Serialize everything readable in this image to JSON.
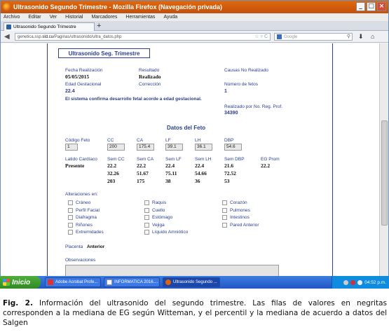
{
  "window": {
    "title": "Ultrasonido Segundo Trimestre - Mozilla Firefox (Navegación privada)",
    "min_symbol": "_",
    "max_symbol": "□",
    "close_symbol": "×"
  },
  "menu": {
    "items": [
      "Archivo",
      "Editar",
      "Ver",
      "Historial",
      "Marcadores",
      "Herramientas",
      "Ayuda"
    ]
  },
  "tab": {
    "label": "Ultrasonido Segundo Trimestre",
    "new_tab": "+"
  },
  "nav": {
    "url_prefix": "genetica.ssp.",
    "url_host": "sld.cu",
    "url_path": "/Paginas/ultrasonido/ultra_datos.php",
    "url_icons": "☆ ▿ C",
    "search_placeholder": "Google",
    "back_symbol": "◀",
    "download_symbol": "⬇",
    "home_symbol": "⌂"
  },
  "page": {
    "section_title": "Ultrasonido Seg. Trimestre",
    "fecha_label": "Fecha Realización",
    "fecha_value": "05/05/2015",
    "resultado_label": "Resultado",
    "resultado_value": "Realizado",
    "causas_label": "Causas No Realizado",
    "edad_label": "Edad Gestacional",
    "edad_value": "22.4",
    "correccion_label": "Corrección",
    "fetos_label": "Número de fetos",
    "fetos_value": "1",
    "confirm_msg": "El sistema confirma desarrollo fetal acorde a edad gestacional.",
    "realizado_label": "Realizado por No. Reg. Prof.",
    "realizado_value": "34390",
    "datos_title": "Datos del Feto",
    "fields": [
      {
        "label": "Código Feto",
        "value": "1"
      },
      {
        "label": "CC",
        "value": "200"
      },
      {
        "label": "CA",
        "value": "175.4"
      },
      {
        "label": "LF",
        "value": "39.1"
      },
      {
        "label": "LH",
        "value": "36.1"
      },
      {
        "label": "DBP",
        "value": "54.6"
      }
    ],
    "latido_label": "Latido Cardíaco",
    "latido_value": "Presente",
    "sem_headers": [
      "Sem CC",
      "Sem CA",
      "Sem LF",
      "Sem LH",
      "Sem DBP",
      "EG Prom"
    ],
    "sem_rows": [
      [
        "22.2",
        "22.2",
        "22.4",
        "22.4",
        "21.6",
        "22.2"
      ],
      [
        "32.26",
        "51.67",
        "75.11",
        "54.66",
        "72.52",
        ""
      ],
      [
        "203",
        "175",
        "38",
        "36",
        "53",
        ""
      ]
    ],
    "alteraciones_label": "Alteraciones en:",
    "checkboxes": [
      "Cráneo",
      "Raquis",
      "Corazón",
      "Perfil Facial",
      "Cuello",
      "Pulmones",
      "Diafragma",
      "Estómago",
      "Intestinos",
      "Riñones",
      "Vejiga",
      "Pared Anterior",
      "Extremidades",
      "Líquido Amniótico"
    ],
    "placenta_label": "Placenta",
    "placenta_value": "Anterior",
    "observaciones_label": "Observaciones"
  },
  "taskbar": {
    "start": "Inicio",
    "tasks": [
      "Adobe Acrobat Profe...",
      "INFORMATICA 2016....",
      "Ultrasonido Segundo ..."
    ],
    "clock": "04:52 p.m."
  },
  "caption": {
    "prefix": "Fig. 2.",
    "text": " Información del ultrasonido del segundo trimestre. Las filas de valores en negritas corresponden a la mediana de EG según Witteman,  y el percentil  y  la mediana  de acuerdo a datos del  Salgen"
  },
  "colors": {
    "label_blue": "#2a3f8f",
    "titlebar": "#c2500a",
    "taskbar": "#2456c4"
  }
}
